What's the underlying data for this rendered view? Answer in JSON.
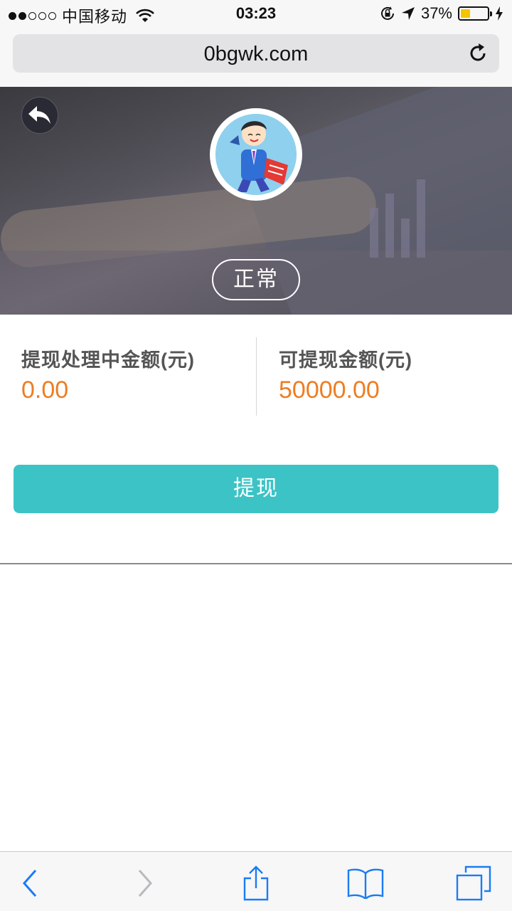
{
  "status_bar": {
    "carrier": "中国移动",
    "time": "03:23",
    "battery": "37%",
    "battery_level": 0.37,
    "colors": {
      "battery_fill": "#f5c400"
    }
  },
  "browser": {
    "url": "0bgwk.com"
  },
  "hero": {
    "status_label": "正常",
    "back_icon": "back-arrow-icon",
    "avatar_icon": "cartoon-businessman-avatar"
  },
  "balances": {
    "processing_label": "提现处理中金额(元)",
    "processing_value": "0.00",
    "available_label": "可提现金额(元)",
    "available_value": "50000.00",
    "colors": {
      "value": "#ee7d22"
    }
  },
  "actions": {
    "withdraw_label": "提现",
    "colors": {
      "button": "#3cc3c5"
    }
  },
  "toolbar": {
    "icons": [
      "chevron-left-icon",
      "chevron-right-icon",
      "share-icon",
      "bookmarks-icon",
      "tabs-icon"
    ],
    "colors": {
      "accent": "#1a7cf5"
    }
  }
}
